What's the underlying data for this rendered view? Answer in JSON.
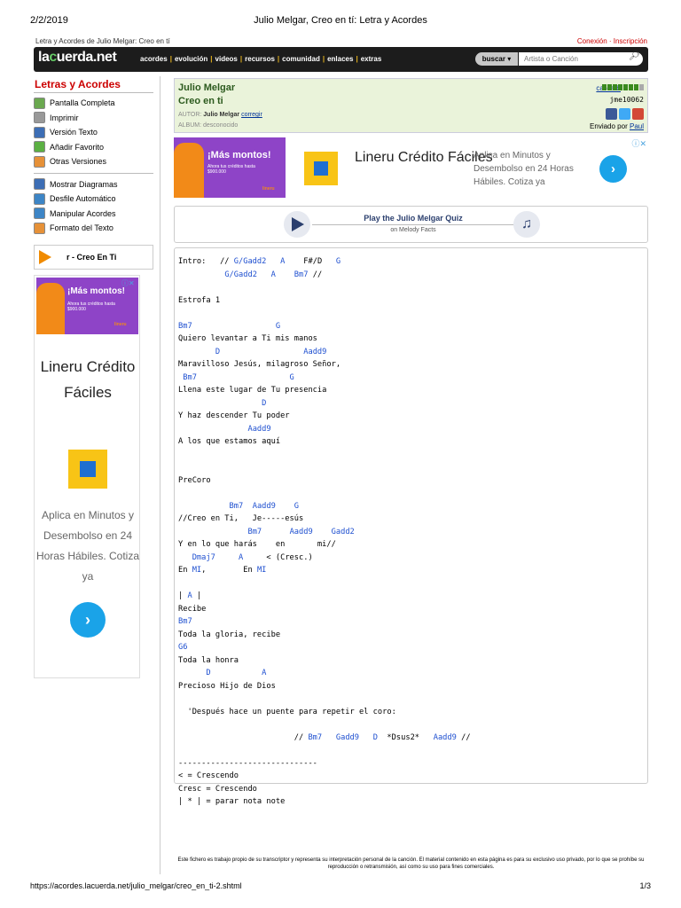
{
  "print_header": {
    "date": "2/2/2019",
    "title": "Julio Melgar, Creo en tí: Letra y Acordes"
  },
  "subheader": {
    "breadcrumb": "Letra y Acordes de Julio Melgar: Creo en tí",
    "login": "Conexión · Inscripción"
  },
  "topbar": {
    "logo_pre": "la",
    "logo_dot": "c",
    "logo_post": "uerda.net",
    "nav": [
      "acordes",
      "evolución",
      "videos",
      "recursos",
      "comunidad",
      "enlaces",
      "extras"
    ],
    "search_label": "buscar ▾",
    "search_placeholder": "Artista o Canción",
    "search_icon": "search-icon"
  },
  "sidebar": {
    "title": "Letras y Acordes",
    "items": [
      {
        "label": "Pantalla Completa",
        "color": "#6aa84f"
      },
      {
        "label": "Imprimir",
        "color": "#999999"
      },
      {
        "label": "Versión Texto",
        "color": "#3d6eb5"
      },
      {
        "label": "Añadir Favorito",
        "color": "#5bb043"
      },
      {
        "label": "Otras Versiones",
        "color": "#e69138"
      }
    ],
    "items2": [
      {
        "label": "Mostrar Diagramas",
        "color": "#3d6eb5"
      },
      {
        "label": "Desfile Automático",
        "color": "#3d85c6"
      },
      {
        "label": "Manipular Acordes",
        "color": "#3d85c6"
      },
      {
        "label": "Formato del Texto",
        "color": "#e69138"
      }
    ],
    "player_text": "r - Creo En Ti"
  },
  "side_ad": {
    "banner_title": "¡Más montos!",
    "banner_sub": "Ahora tus créditos hasta $900.000",
    "banner_logo": "lineru",
    "title": "Lineru Crédito Fáciles",
    "desc": "Aplica en Minutos y Desembolso en 24 Horas Hábiles. Cotiza ya",
    "close": "ⓘ✕",
    "arrow": "›"
  },
  "song": {
    "artist": "Julio Melgar",
    "title": "Creo en ti",
    "autor_label": "AUTOR:",
    "autor_value": "Julio Melgar",
    "autor_link": "corregir",
    "album_label": "ALBUM:",
    "album_value": "desconocido",
    "calidad_label": "calidad:",
    "quality_filled": 7,
    "quality_total": 8,
    "user": "jme10062",
    "sent_label": "Enviado por",
    "sent_user": "Paul"
  },
  "main_ad": {
    "banner_title": "¡Más montos!",
    "banner_sub": "Ahora tus créditos hasta $900.000",
    "banner_logo": "lineru",
    "title": "Lineru Crédito Fáciles",
    "desc": "Aplica en Minutos y Desembolso en 24 Horas Hábiles. Cotiza ya",
    "close": "ⓘ✕",
    "arrow": "›"
  },
  "quiz": {
    "title": "Play the Julio Melgar Quiz",
    "sub": "on Melody Facts"
  },
  "lyrics": [
    [
      {
        "t": "Intro:   // "
      },
      {
        "c": "G/Gadd2"
      },
      {
        "t": "   "
      },
      {
        "c": "A"
      },
      {
        "t": "    F#/D   "
      },
      {
        "c": "G"
      }
    ],
    [
      {
        "t": "          "
      },
      {
        "c": "G/Gadd2"
      },
      {
        "t": "   "
      },
      {
        "c": "A"
      },
      {
        "t": "    "
      },
      {
        "c": "Bm7"
      },
      {
        "t": " //"
      }
    ],
    [
      {
        "t": ""
      }
    ],
    [
      {
        "t": "Estrofa 1"
      }
    ],
    [
      {
        "t": ""
      }
    ],
    [
      {
        "c": "Bm7"
      },
      {
        "t": "                  "
      },
      {
        "c": "G"
      }
    ],
    [
      {
        "t": "Quiero levantar a Ti mis manos"
      }
    ],
    [
      {
        "t": "        "
      },
      {
        "c": "D"
      },
      {
        "t": "                  "
      },
      {
        "c": "Aadd9"
      }
    ],
    [
      {
        "t": "Maravilloso Jesús, milagroso Señor,"
      }
    ],
    [
      {
        "t": " "
      },
      {
        "c": "Bm7"
      },
      {
        "t": "                    "
      },
      {
        "c": "G"
      }
    ],
    [
      {
        "t": "Llena este lugar de Tu presencia"
      }
    ],
    [
      {
        "t": "                  "
      },
      {
        "c": "D"
      }
    ],
    [
      {
        "t": "Y haz descender Tu poder"
      }
    ],
    [
      {
        "t": "               "
      },
      {
        "c": "Aadd9"
      }
    ],
    [
      {
        "t": "A los que estamos aquí"
      }
    ],
    [
      {
        "t": ""
      }
    ],
    [
      {
        "t": ""
      }
    ],
    [
      {
        "t": "PreCoro"
      }
    ],
    [
      {
        "t": ""
      }
    ],
    [
      {
        "t": "           "
      },
      {
        "c": "Bm7"
      },
      {
        "t": "  "
      },
      {
        "c": "Aadd9"
      },
      {
        "t": "    "
      },
      {
        "c": "G"
      }
    ],
    [
      {
        "t": "//Creo en Ti,   Je-----esús"
      }
    ],
    [
      {
        "t": "               "
      },
      {
        "c": "Bm7"
      },
      {
        "t": "      "
      },
      {
        "c": "Aadd9"
      },
      {
        "t": "    "
      },
      {
        "c": "Gadd2"
      }
    ],
    [
      {
        "t": "Y en lo que harás    en       mi//"
      }
    ],
    [
      {
        "t": "   "
      },
      {
        "c": "Dmaj7"
      },
      {
        "t": "     "
      },
      {
        "c": "A"
      },
      {
        "t": "     < (Cresc.)"
      }
    ],
    [
      {
        "t": "En "
      },
      {
        "c": "MI"
      },
      {
        "t": ",        En "
      },
      {
        "c": "MI"
      }
    ],
    [
      {
        "t": ""
      }
    ],
    [
      {
        "t": "| "
      },
      {
        "c": "A"
      },
      {
        "t": " |"
      }
    ],
    [
      {
        "t": "Recibe"
      }
    ],
    [
      {
        "c": "Bm7"
      }
    ],
    [
      {
        "t": "Toda la gloria, recibe"
      }
    ],
    [
      {
        "c": "G6"
      }
    ],
    [
      {
        "t": "Toda la honra"
      }
    ],
    [
      {
        "t": "      "
      },
      {
        "c": "D"
      },
      {
        "t": "           "
      },
      {
        "c": "A"
      }
    ],
    [
      {
        "t": "Precioso Hijo de Dios"
      }
    ],
    [
      {
        "t": ""
      }
    ],
    [
      {
        "t": "  'Después hace un puente para repetir el coro:"
      }
    ],
    [
      {
        "t": ""
      }
    ],
    [
      {
        "t": "                         // "
      },
      {
        "c": "Bm7"
      },
      {
        "t": "   "
      },
      {
        "c": "Gadd9"
      },
      {
        "t": "   "
      },
      {
        "c": "D"
      },
      {
        "t": "  *Dsus2*   "
      },
      {
        "c": "Aadd9"
      },
      {
        "t": " //"
      }
    ],
    [
      {
        "t": ""
      }
    ],
    [
      {
        "t": "------------------------------"
      }
    ],
    [
      {
        "t": "< = Crescendo"
      }
    ],
    [
      {
        "t": "Cresc = Crescendo"
      }
    ],
    [
      {
        "t": "| * | = parar nota note"
      }
    ]
  ],
  "footer_note": "Este fichero es trabajo propio de su transcriptor y representa su interpretación personal de la canción. El material contenido en esta página es para su exclusivo uso privado, por lo que se prohíbe su reproducción o retransmisión, así como su uso para fines comerciales.",
  "print_footer": {
    "url": "https://acordes.lacuerda.net/julio_melgar/creo_en_ti-2.shtml",
    "page": "1/3"
  }
}
